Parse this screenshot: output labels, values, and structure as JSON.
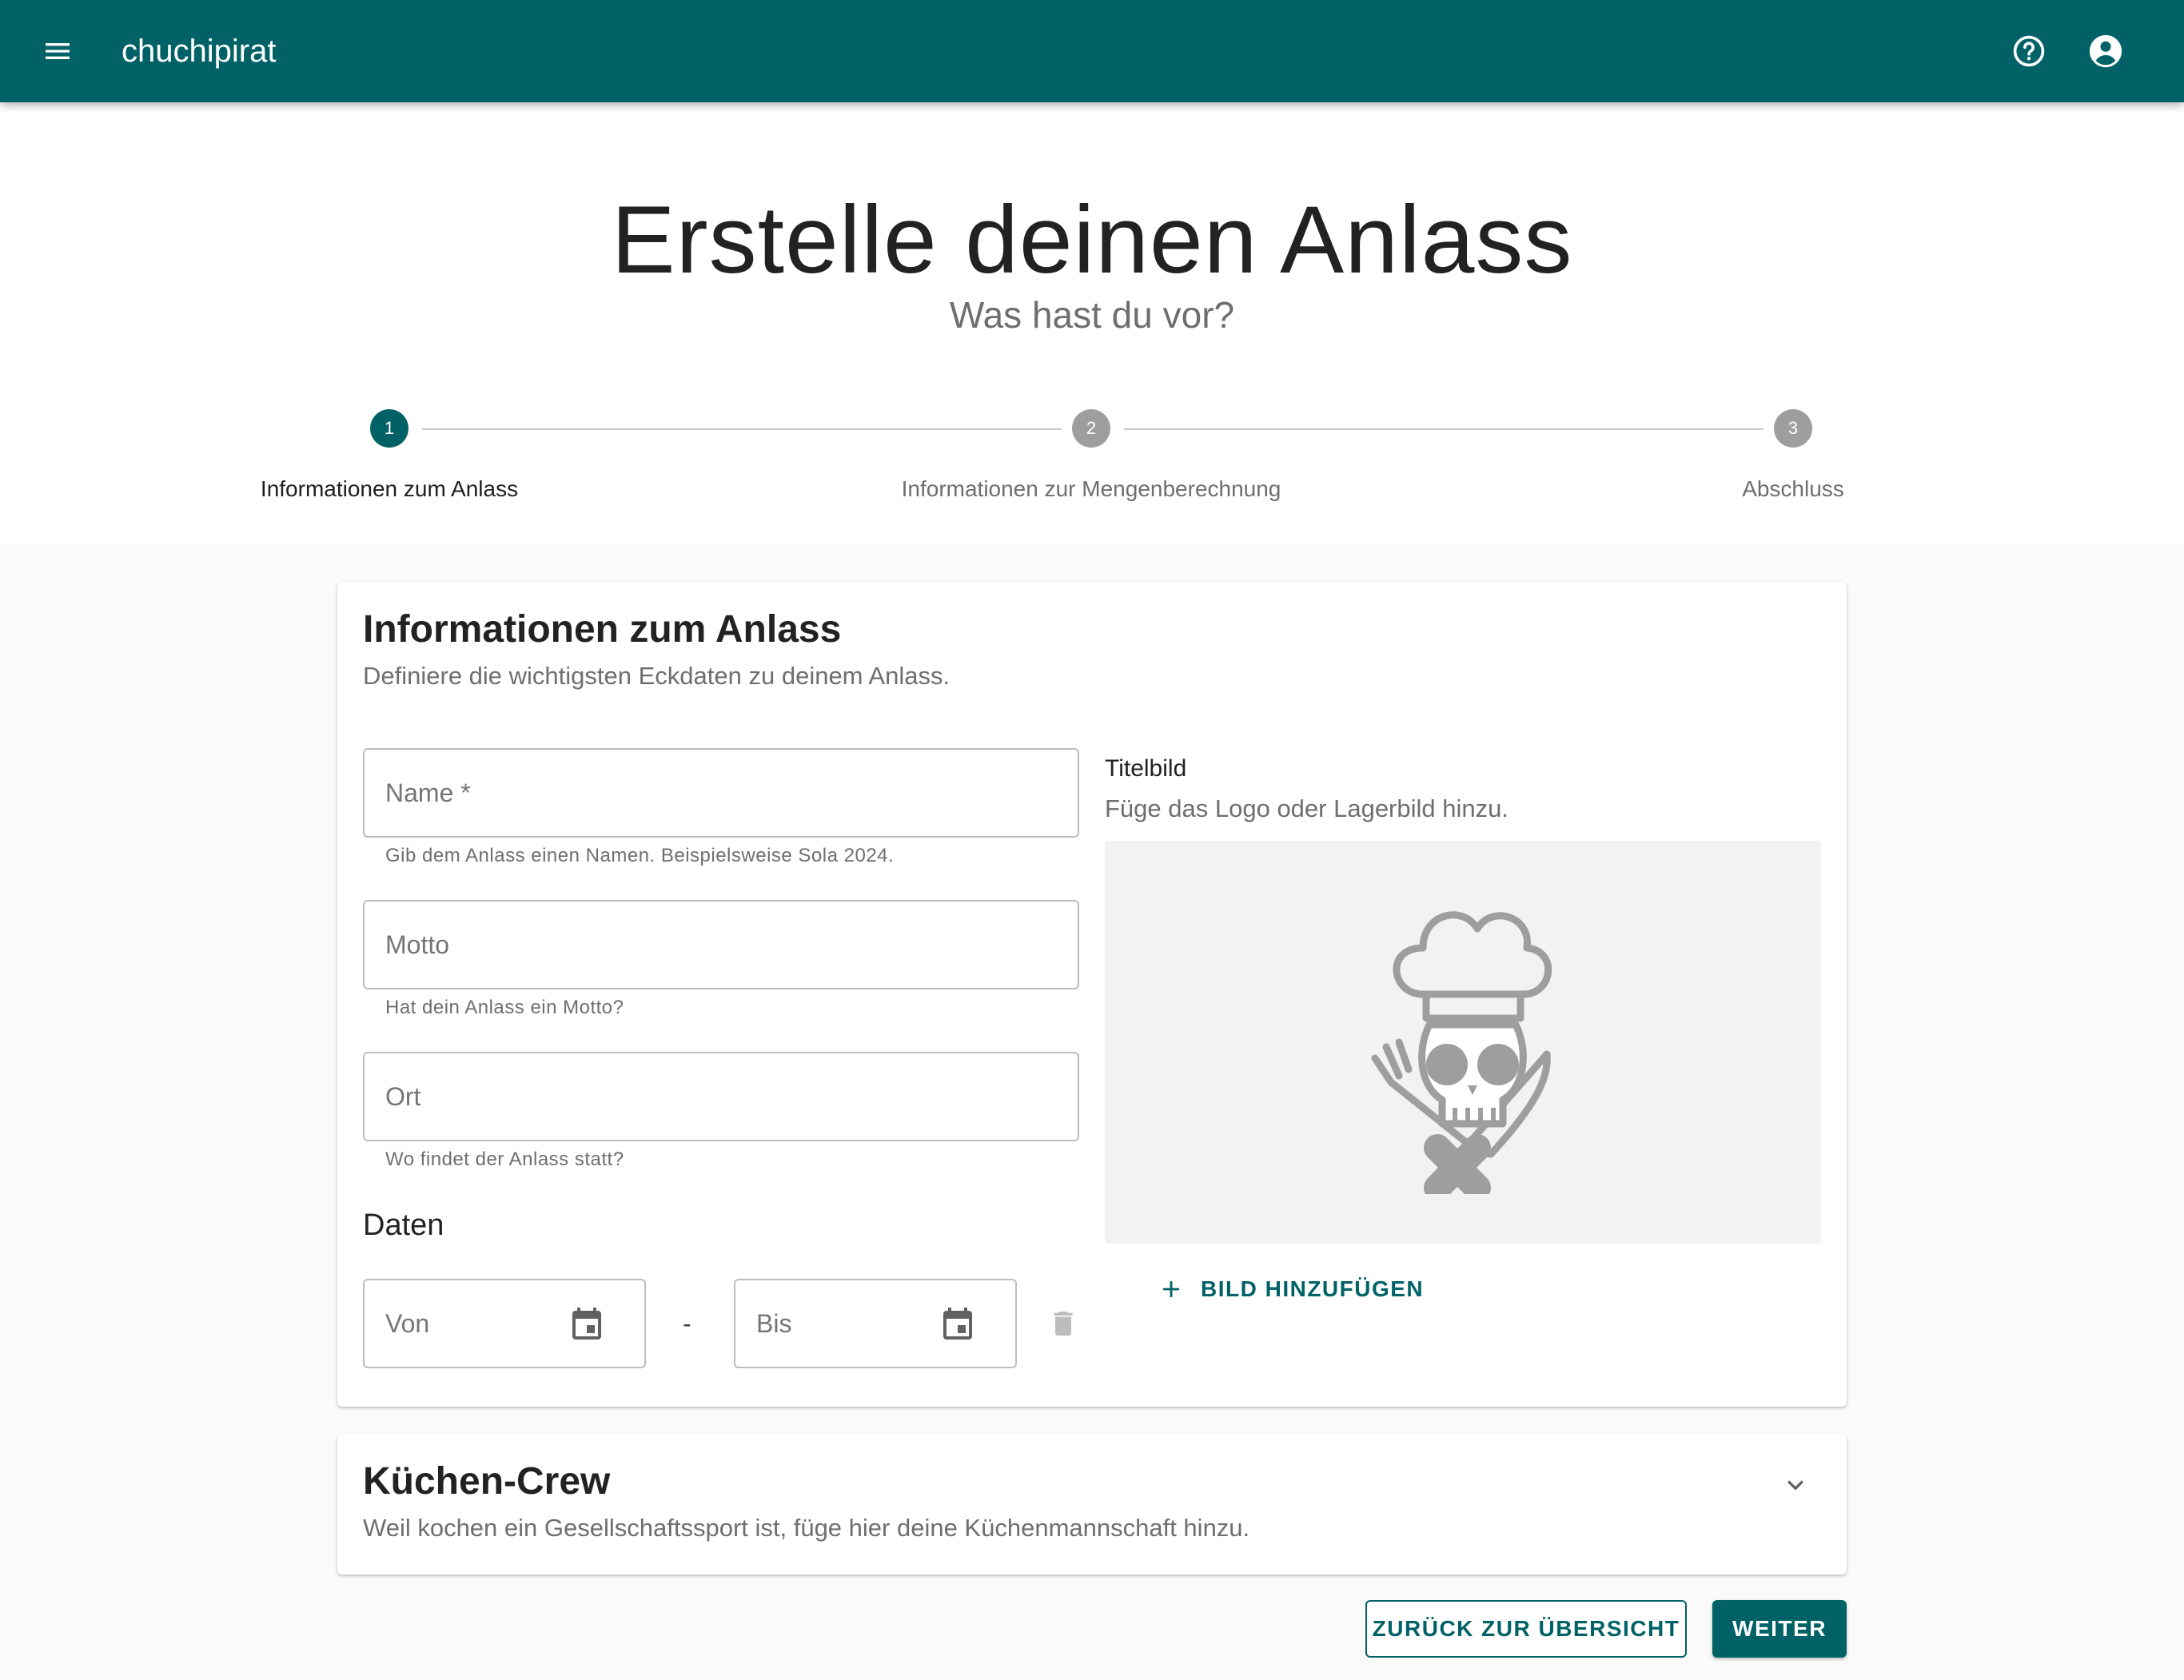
{
  "appbar": {
    "title": "chuchipirat",
    "icons": {
      "menu": "menu-icon",
      "help": "help-circle-icon",
      "account": "account-circle-icon"
    }
  },
  "hero": {
    "title": "Erstelle deinen Anlass",
    "subtitle": "Was hast du vor?"
  },
  "stepper": {
    "steps": [
      {
        "number": "1",
        "label": "Informationen zum Anlass",
        "active": true
      },
      {
        "number": "2",
        "label": "Informationen zur Mengenberechnung",
        "active": false
      },
      {
        "number": "3",
        "label": "Abschluss",
        "active": false
      }
    ]
  },
  "info_card": {
    "title": "Informationen zum Anlass",
    "subtitle": "Definiere die wichtigsten Eckdaten zu deinem Anlass.",
    "fields": {
      "name": {
        "label": "Name *",
        "value": "",
        "hint": "Gib dem Anlass einen Namen. Beispielsweise Sola 2024."
      },
      "motto": {
        "label": "Motto",
        "value": "",
        "hint": "Hat dein Anlass ein Motto?"
      },
      "ort": {
        "label": "Ort",
        "value": "",
        "hint": "Wo findet der Anlass statt?"
      }
    },
    "dates": {
      "heading": "Daten",
      "from_label": "Von",
      "separator": "-",
      "to_label": "Bis"
    },
    "image": {
      "label": "Titelbild",
      "hint": "Füge das Logo oder Lagerbild hinzu.",
      "add_button": "BILD HINZUFÜGEN"
    }
  },
  "crew_card": {
    "title": "Küchen-Crew",
    "subtitle": "Weil kochen ein Gesellschaftssport ist, füge hier deine Küchenmannschaft hinzu."
  },
  "actions": {
    "back_label": "ZURÜCK ZUR ÜBERSICHT",
    "next_label": "WEITER"
  },
  "colors": {
    "primary": "#006266",
    "inactive_step": "#9e9e9e"
  }
}
